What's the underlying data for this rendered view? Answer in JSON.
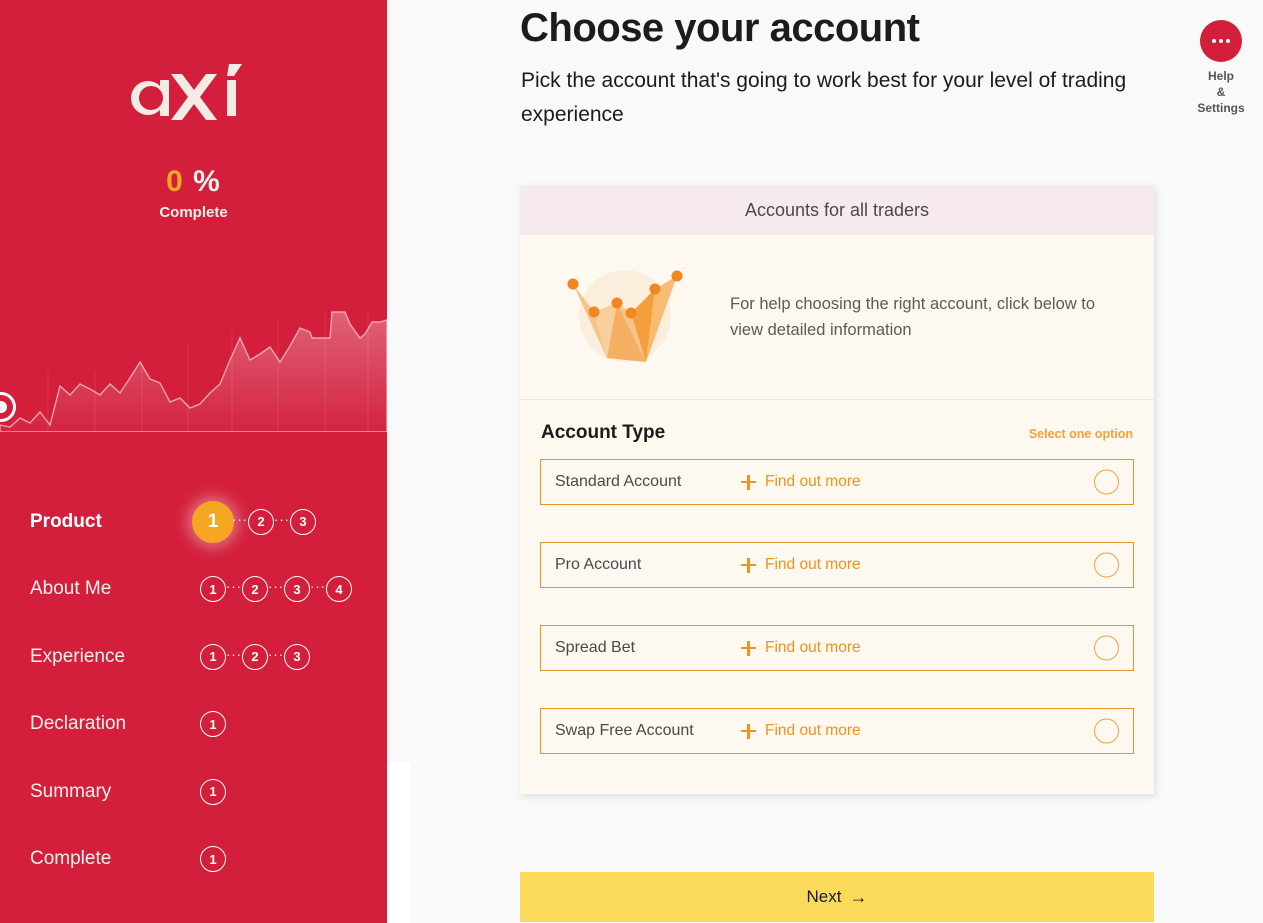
{
  "sidebar": {
    "logo_alt": "axi",
    "progress_value": "0 %",
    "progress_label": "Complete",
    "steps": [
      {
        "label": "Product",
        "active": true,
        "dots": [
          "1",
          "2",
          "3"
        ],
        "current_index": 0
      },
      {
        "label": "About Me",
        "active": false,
        "dots": [
          "1",
          "2",
          "3",
          "4"
        ],
        "current_index": -1
      },
      {
        "label": "Experience",
        "active": false,
        "dots": [
          "1",
          "2",
          "3"
        ],
        "current_index": -1
      },
      {
        "label": "Declaration",
        "active": false,
        "dots": [
          "1"
        ],
        "current_index": -1
      },
      {
        "label": "Summary",
        "active": false,
        "dots": [
          "1"
        ],
        "current_index": -1
      },
      {
        "label": "Complete",
        "active": false,
        "dots": [
          "1"
        ],
        "current_index": -1
      }
    ],
    "brand_color": "#d31f3c",
    "accent_color": "#f5a623"
  },
  "header": {
    "title": "Choose your account",
    "subtitle": "Pick the account that's going to work best for your level of trading experience",
    "help": {
      "icon": "ellipsis-icon",
      "line1": "Help",
      "line2": "&",
      "line3": "Settings"
    }
  },
  "card": {
    "header_title": "Accounts for all traders",
    "illustration_icon": "crown-chart-illustration",
    "illustration_text": "For help choosing the right account, click below to view detailed information",
    "section_title": "Account Type",
    "section_hint": "Select one option",
    "find_out_more_label": "Find out more",
    "options": [
      {
        "name": "Standard Account",
        "selected": false
      },
      {
        "name": "Pro Account",
        "selected": false
      },
      {
        "name": "Spread Bet",
        "selected": false
      },
      {
        "name": "Swap Free Account",
        "selected": false
      }
    ],
    "header_bg": "#f7eaec",
    "body_bg": "#fdf8f0",
    "border_color": "#e8922a"
  },
  "footer": {
    "next_label": "Next",
    "next_arrow": "→",
    "next_bg": "#fbd95b"
  },
  "chart_data": {
    "type": "area",
    "title": "",
    "x": [
      0,
      1,
      2,
      3,
      4,
      5,
      6,
      7,
      8,
      9,
      10,
      11,
      12,
      13,
      14,
      15,
      16,
      17,
      18,
      19,
      20,
      21,
      22,
      23,
      24,
      25,
      26,
      27,
      28,
      29,
      30,
      31,
      32,
      33,
      34,
      35,
      36,
      37,
      38
    ],
    "values": [
      4,
      3,
      8,
      5,
      10,
      4,
      29,
      22,
      30,
      26,
      22,
      30,
      23,
      35,
      46,
      33,
      30,
      19,
      22,
      14,
      17,
      25,
      30,
      44,
      62,
      46,
      49,
      55,
      44,
      56,
      70,
      68,
      62,
      62,
      62,
      84,
      72,
      60,
      68,
      66
    ],
    "grid": false,
    "legend": false
  }
}
